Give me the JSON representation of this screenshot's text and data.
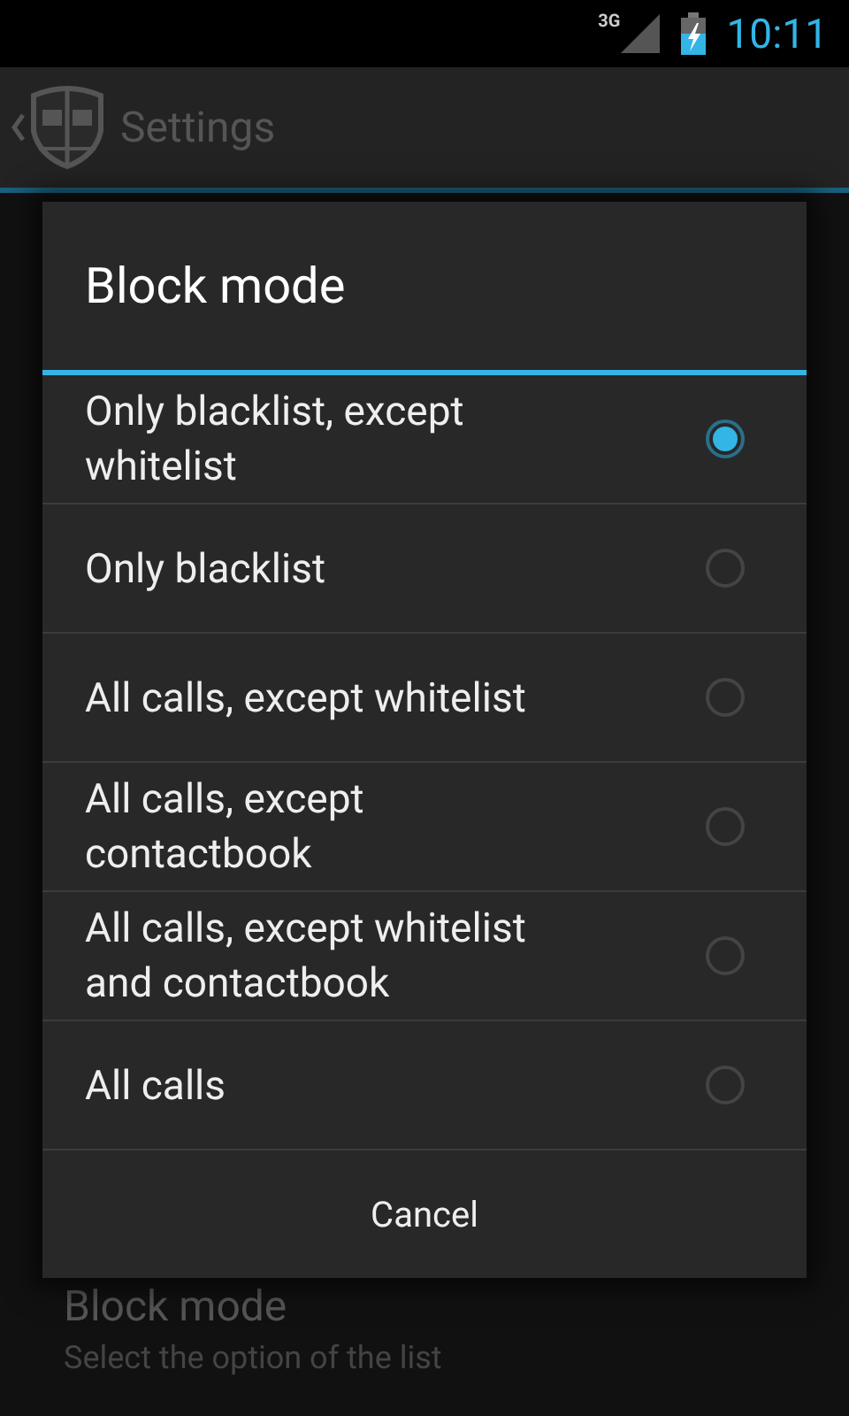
{
  "status_bar": {
    "network": "3G",
    "time": "10:11"
  },
  "action_bar": {
    "title": "Settings"
  },
  "setting": {
    "title": "Block mode",
    "summary": "Select the option of the list"
  },
  "dialog": {
    "title": "Block mode",
    "options": [
      {
        "label": "Only blacklist, except whitelist",
        "selected": true
      },
      {
        "label": "Only blacklist",
        "selected": false
      },
      {
        "label": "All calls, except whitelist",
        "selected": false
      },
      {
        "label": "All calls, except contactbook",
        "selected": false
      },
      {
        "label": "All calls, except whitelist and contactbook",
        "selected": false
      },
      {
        "label": "All calls",
        "selected": false
      }
    ],
    "button": "Cancel"
  }
}
